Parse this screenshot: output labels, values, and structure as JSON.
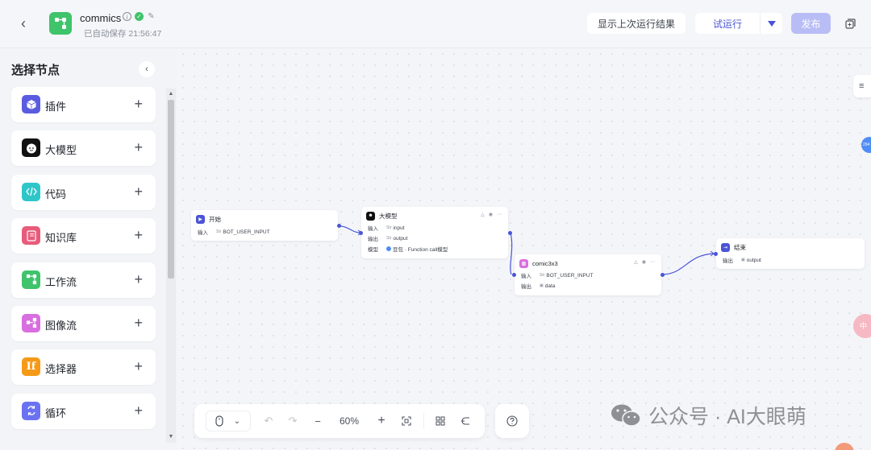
{
  "header": {
    "app_name": "commics",
    "autosave": "已自动保存 21:56:47",
    "btn_last_result": "显示上次运行结果",
    "btn_test_run": "试运行",
    "btn_publish": "发布"
  },
  "sidebar": {
    "title": "选择节点",
    "items": [
      {
        "label": "插件",
        "color": "#5a5ce0"
      },
      {
        "label": "大模型",
        "color": "#111111"
      },
      {
        "label": "代码",
        "color": "#2fc6c8"
      },
      {
        "label": "知识库",
        "color": "#e85c7b"
      },
      {
        "label": "工作流",
        "color": "#3fc36b"
      },
      {
        "label": "图像流",
        "color": "#d86ee0"
      },
      {
        "label": "选择器",
        "color": "#f59a17"
      },
      {
        "label": "循环",
        "color": "#6b72f2"
      }
    ]
  },
  "workflow": {
    "start": {
      "title": "开始",
      "in_label": "输入",
      "in_type": "Str",
      "in_value": "BOT_USER_INPUT"
    },
    "llm": {
      "title": "大模型",
      "in_label": "输入",
      "in_type": "Str",
      "in_value": "input",
      "out_label": "输出",
      "out_type": "Str",
      "out_value": "output",
      "model_label": "模型",
      "model_value": "豆包 · Function call模型"
    },
    "comic": {
      "title": "comic3x3",
      "in_label": "输入",
      "in_type": "Str",
      "in_value": "BOT_USER_INPUT",
      "out_label": "输出",
      "out_value": "data"
    },
    "end": {
      "title": "结束",
      "out_label": "输出",
      "out_value": "output"
    }
  },
  "toolbar": {
    "zoom": "60%"
  },
  "watermark": {
    "text": "公众号 · AI大眼萌"
  },
  "right_bubble": "294",
  "right_pink": "中"
}
